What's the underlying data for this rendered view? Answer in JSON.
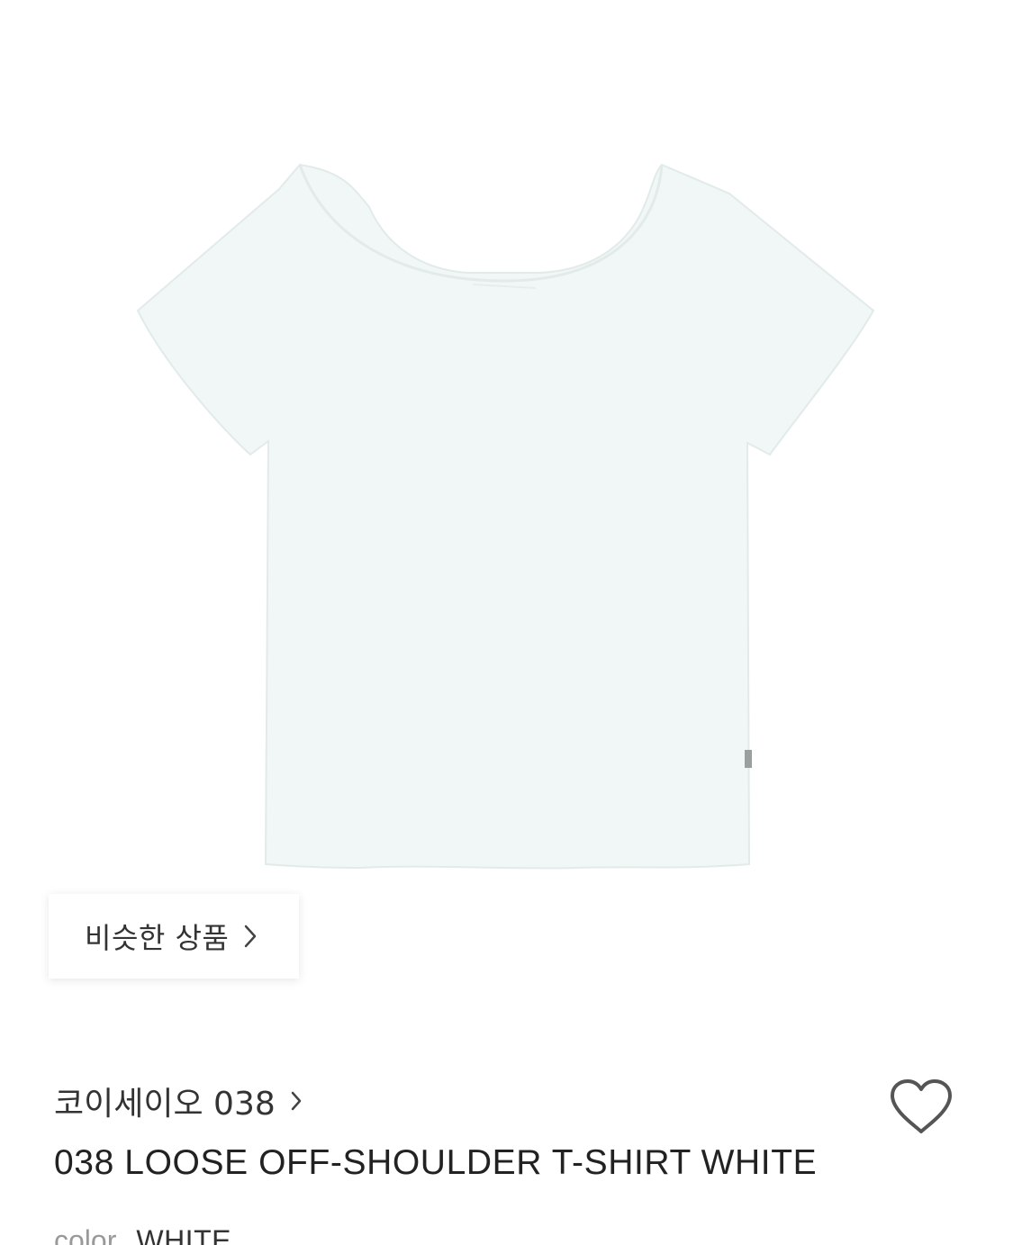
{
  "product": {
    "image_icon": "white-tshirt-photo",
    "similar_button_label": "비슷한 상품",
    "brand_name": "코이세이오 038",
    "title": "038 LOOSE OFF-SHOULDER T-SHIRT WHITE",
    "color_label": "color",
    "color_value": "WHITE",
    "like_icon": "heart-outline-icon"
  },
  "colors": {
    "shirt_fill": "#f0f7f6",
    "shirt_edge": "#e2ebea",
    "text_primary": "#222222",
    "text_muted": "#999999",
    "icon_gray": "#555555"
  }
}
